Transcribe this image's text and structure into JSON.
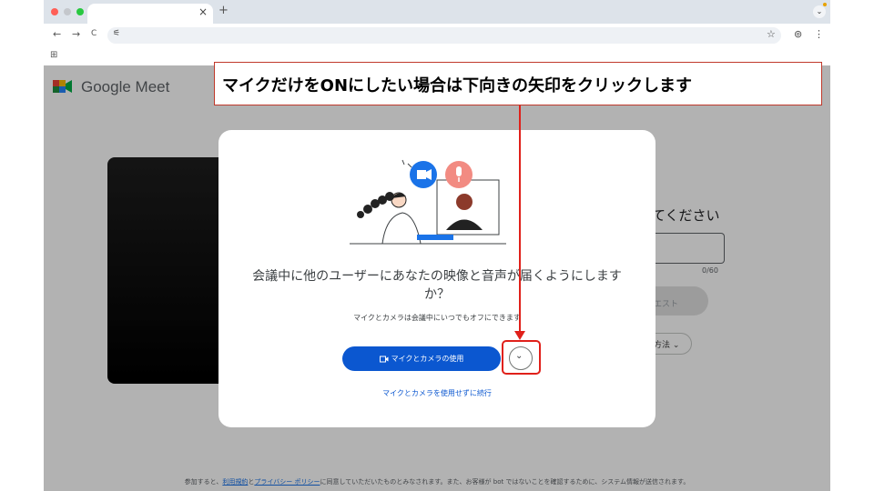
{
  "browser": {
    "tab_close": "×",
    "new_tab": "+",
    "tab_menu": "⌄",
    "nav_back": "←",
    "nav_forward": "→",
    "nav_reload": "C",
    "site_info": "⚟",
    "star": "☆",
    "profile": "⊚",
    "menu": "⋮",
    "apps": "⊞"
  },
  "meet": {
    "product_name": "Google Meet",
    "right_heading": "てください",
    "name_counter": "0/60",
    "join_request": "エスト",
    "other_ways": "方法 ⌄",
    "colors": {
      "primary": "#0b57d0",
      "annotation": "#e0201a"
    }
  },
  "footer": {
    "before": "参加すると、",
    "terms": "利用規約",
    "and": "と",
    "privacy": "プライバシー ポリシー",
    "after": "に同意していただいたものとみなされます。また、お客様が bot ではないことを確認するために、システム情報が送信されます。"
  },
  "dialog": {
    "title": "会議中に他のユーザーにあなたの映像と音声が届くようにしますか？",
    "subtitle": "マイクとカメラは会議中にいつでもオフにできます",
    "use_button": "マイクとカメラの使用",
    "expand_icon": "⌄",
    "skip_link": "マイクとカメラを使用せずに続行"
  },
  "annotation": {
    "callout": "マイクだけをONにしたい場合は下向きの矢印をクリックします"
  }
}
